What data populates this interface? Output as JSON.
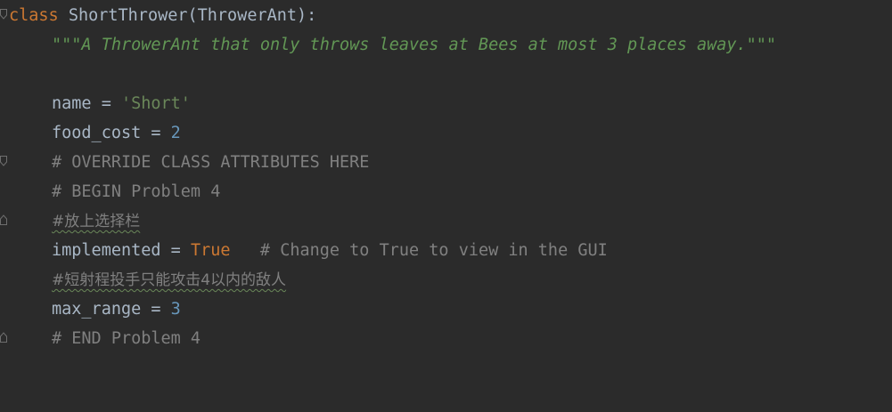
{
  "editor": {
    "lines": [
      {
        "kw": "class",
        "rest": " ShortThrower(ThrowerAnt):"
      },
      {
        "doc": "\"\"\"A ThrowerAnt that only throws leaves at Bees at most 3 places away.\"\"\""
      },
      {},
      {
        "name": "name",
        "eq": " = ",
        "str": "'Short'"
      },
      {
        "name": "food_cost",
        "eq": " = ",
        "num": "2"
      },
      {
        "cmt": "# OVERRIDE CLASS ATTRIBUTES HERE"
      },
      {
        "cmt": "# BEGIN Problem 4"
      },
      {
        "cjk": "#放上选择栏"
      },
      {
        "name": "implemented",
        "eq": " = ",
        "kw": "True",
        "cmt": "   # Change to True to view in the GUI"
      },
      {
        "cjk": "#短射程投手只能攻击4以内的敌人"
      },
      {
        "name": "max_range",
        "eq": " = ",
        "num": "3"
      },
      {
        "cmt": "# END Problem 4"
      }
    ]
  },
  "colors": {
    "background": "#2b2b2b",
    "keyword": "#cc7832",
    "string": "#6a8759",
    "number": "#6897bb",
    "comment": "#808080",
    "identifier": "#a9b7c6"
  },
  "gutter": {
    "fold_icons": [
      "fold-open-icon",
      "fold-close-icon",
      "fold-open-icon",
      "fold-close-icon"
    ]
  }
}
